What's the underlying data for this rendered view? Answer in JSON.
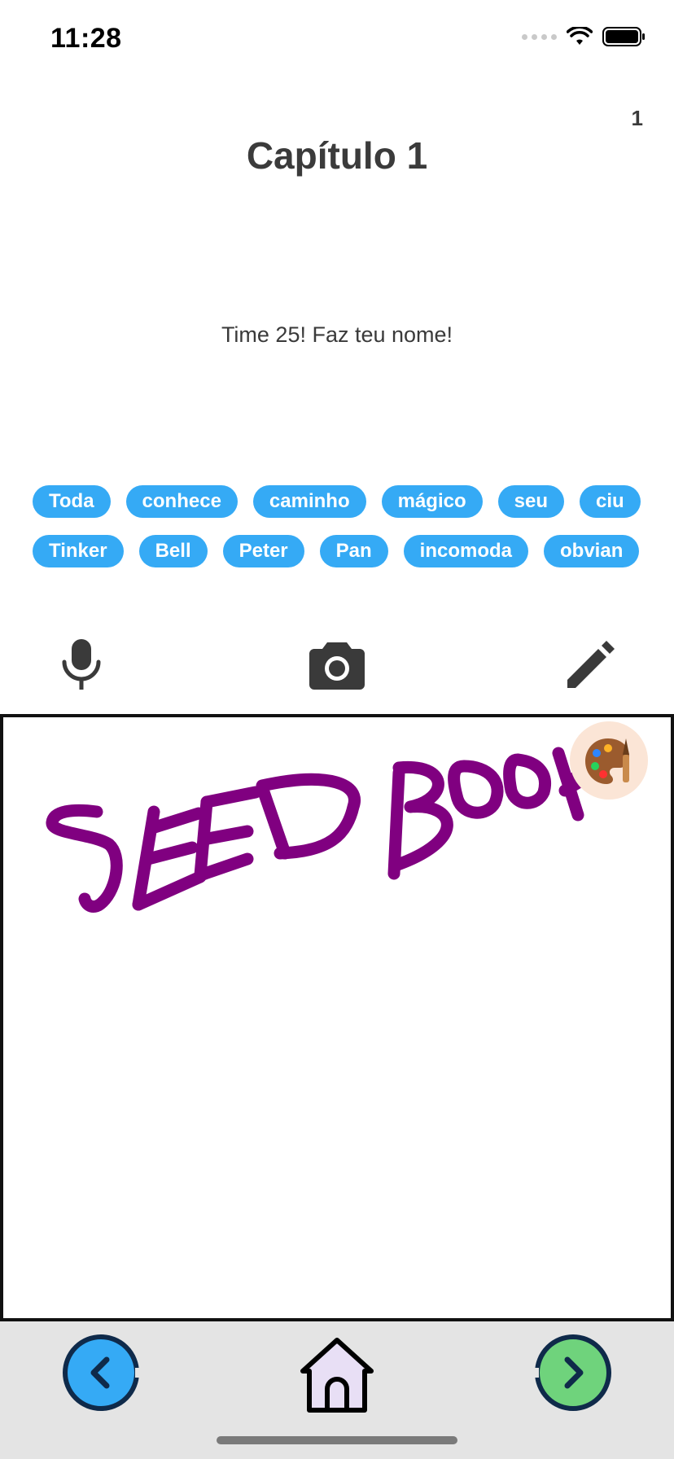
{
  "status": {
    "time": "11:28"
  },
  "page": {
    "number": "1"
  },
  "chapter": {
    "title": "Capítulo 1",
    "text": "Time 25! Faz teu nome!"
  },
  "words": {
    "row1": [
      "Toda",
      "conhece",
      "caminho",
      "mágico",
      "seu",
      "ciu"
    ],
    "row2": [
      "Tinker",
      "Bell",
      "Peter",
      "Pan",
      "incomoda",
      "obvian"
    ]
  },
  "tools": {
    "icons": [
      "microphone-icon",
      "camera-icon",
      "pencil-icon"
    ]
  },
  "drawing": {
    "ink_color": "#800080"
  },
  "colors": {
    "chip": "#35aaf5",
    "prev": "#35aaf5",
    "next": "#6fd37c",
    "home_fill": "#e8dff5"
  }
}
